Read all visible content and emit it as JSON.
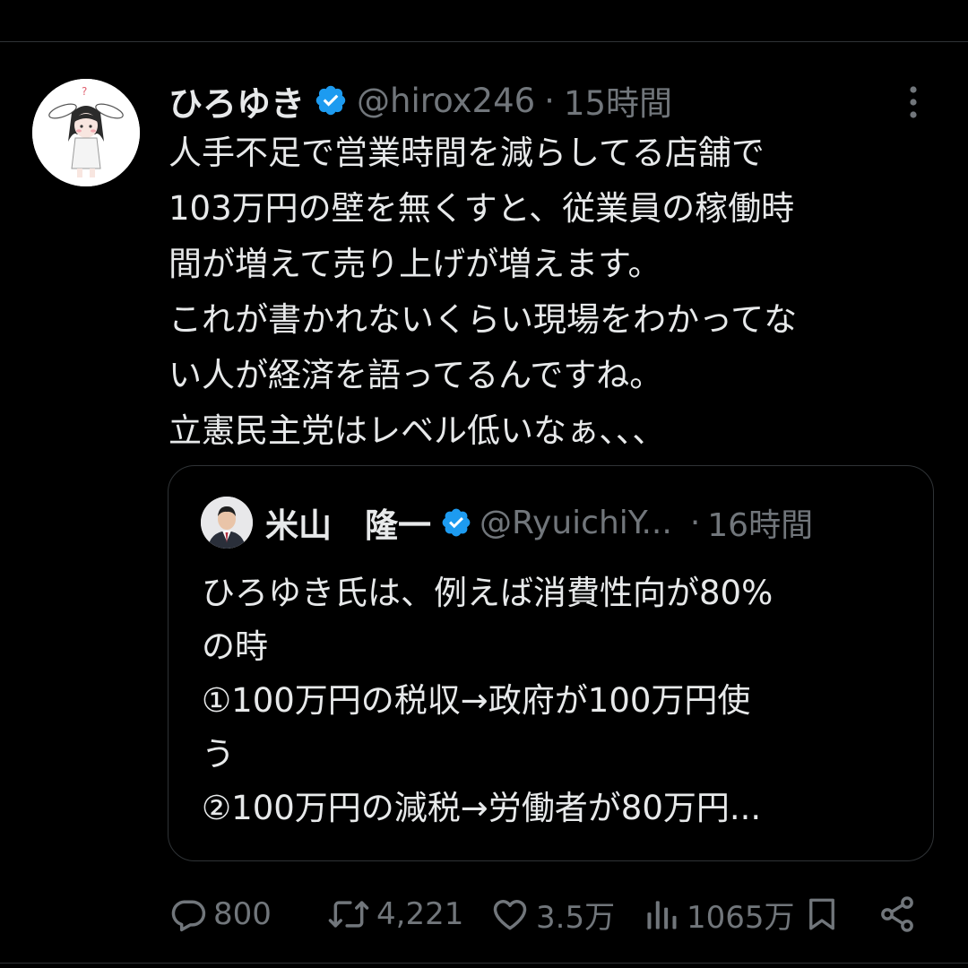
{
  "tweet": {
    "display_name": "ひろゆき",
    "handle": "@hirox246",
    "separator": "·",
    "time": "15時間",
    "verified_color": "#1d9bf0",
    "text": "人手不足で営業時間を減らしてる店舗で\n103万円の壁を無くすと、従業員の稼働時\n間が増えて売り上げが増えます。\nこれが書かれないくらい現場をわかってな\nい人が経済を語ってるんですね。\n立憲民主党はレベル低いなぁ、、、"
  },
  "quote": {
    "display_name": "米山　隆一",
    "handle": "@RyuichiY...",
    "separator": "·",
    "time": "16時間",
    "text": "ひろゆき氏は、例えば消費性向が80%\nの時\n①100万円の税収→政府が100万円使\nう\n②100万円の減税→労働者が80万円..."
  },
  "actions": {
    "replies": "800",
    "retweets": "4,221",
    "likes": "3.5万",
    "views": "1065万",
    "icons": [
      "reply-icon",
      "retweet-icon",
      "like-icon",
      "views-icon",
      "bookmark-icon",
      "share-icon"
    ]
  }
}
